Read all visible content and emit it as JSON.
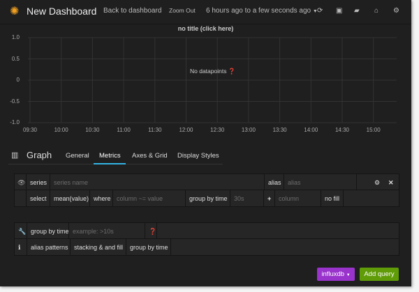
{
  "nav": {
    "title": "New Dashboard",
    "back": "Back to dashboard",
    "zoom_out": "Zoom Out",
    "time_range": "6 hours ago to a few seconds ago",
    "icons": [
      "refresh-icon",
      "save-icon",
      "folder-open-icon",
      "home-icon",
      "gear-icon"
    ]
  },
  "chart_data": {
    "type": "line",
    "title": "no title (click here)",
    "message": "No datapoints",
    "ylim": [
      -1.0,
      1.0
    ],
    "yticks": [
      "1.0",
      "0.5",
      "0",
      "-0.5",
      "-1.0"
    ],
    "xticks": [
      "09:30",
      "10:00",
      "10:30",
      "11:00",
      "11:30",
      "12:00",
      "12:30",
      "13:00",
      "13:30",
      "14:00",
      "14:30",
      "15:00"
    ],
    "grid": true,
    "series": []
  },
  "editor": {
    "title": "Graph",
    "tabs": [
      "General",
      "Metrics",
      "Axes & Grid",
      "Display Styles"
    ],
    "active_tab": "Metrics"
  },
  "query": {
    "series_label": "series",
    "series_placeholder": "series name",
    "alias_label": "alias",
    "alias_placeholder": "alias",
    "select_label": "select",
    "select_value": "mean(value)",
    "where_label": "where",
    "where_placeholder": "column ~= value",
    "group_label": "group by time",
    "group_placeholder": "30s",
    "plus": "+",
    "column_placeholder": "column",
    "fill": "no fill"
  },
  "options": {
    "group_label": "group by time",
    "group_placeholder": "example: >10s",
    "help": [
      "alias patterns",
      "stacking & and fill",
      "group by time"
    ]
  },
  "buttons": {
    "datasource": "influxdb",
    "add_query": "Add query"
  },
  "colors": {
    "accent": "#33b5e5",
    "datasource": "#9933cc",
    "add": "#5f9c08"
  }
}
